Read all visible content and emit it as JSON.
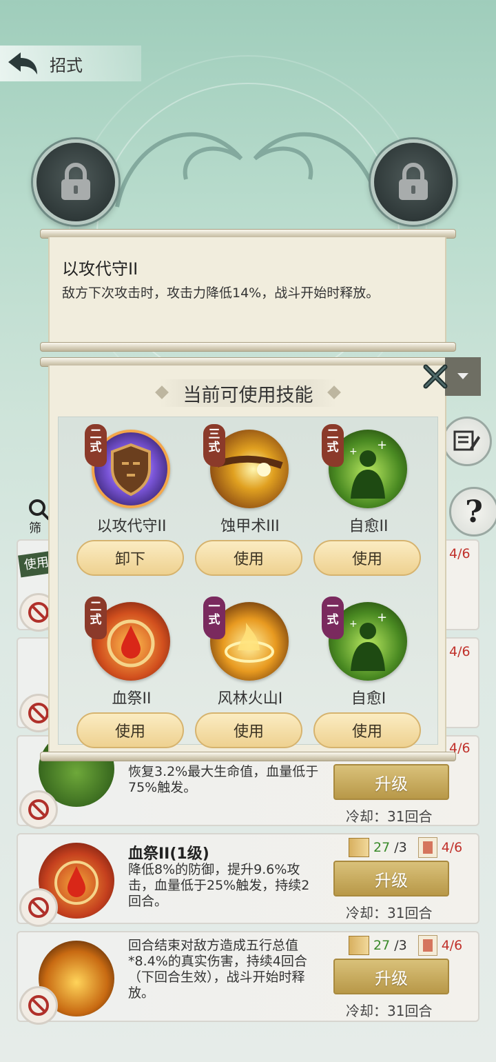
{
  "header": {
    "back_label": "招式"
  },
  "info": {
    "title": "以攻代守II",
    "description": "敌方下次攻击时，攻击力降低14%，战斗开始时释放。"
  },
  "picker": {
    "heading": "当前可使用技能",
    "skills": [
      {
        "tier": "二式",
        "name": "以攻代守II",
        "action": "卸下"
      },
      {
        "tier": "三式",
        "name": "蚀甲术III",
        "action": "使用"
      },
      {
        "tier": "二式",
        "name": "自愈II",
        "action": "使用"
      },
      {
        "tier": "二式",
        "name": "血祭II",
        "action": "使用"
      },
      {
        "tier": "一式",
        "name": "风林火山I",
        "action": "使用"
      },
      {
        "tier": "一式",
        "name": "自愈I",
        "action": "使用"
      }
    ]
  },
  "sidebar": {
    "filter_label": "筛",
    "help_symbol": "?",
    "badge": "使用"
  },
  "list": {
    "cards": [
      {
        "count_right": "4/6"
      },
      {
        "count_right": "4/6"
      },
      {
        "count_right": "4/6",
        "desc": "恢复3.2%最大生命值，血量低于75%触发。",
        "upgrade": "升级",
        "cooldown": "冷却：31回合"
      },
      {
        "title": "血祭II(1级)",
        "desc": "降低8%的防御，提升9.6%攻击，血量低于25%触发，持续2回合。",
        "count_green": "27",
        "count_total": "/3",
        "count_right": "4/6",
        "upgrade": "升级",
        "cooldown": "冷却：31回合"
      },
      {
        "desc": "回合结束对敌方造成五行总值*8.4%的真实伤害，持续4回合（下回合生效），战斗开始时释放。",
        "count_green": "27",
        "count_total": "/3",
        "count_right": "4/6",
        "upgrade": "升级",
        "cooldown": "冷却：31回合"
      }
    ]
  },
  "colors": {
    "accent_gold": "#d9c17a",
    "button_cream": "#f6e2a8",
    "tier_brown": "#8b3a2a",
    "tier_purple": "#7a2a5e"
  }
}
